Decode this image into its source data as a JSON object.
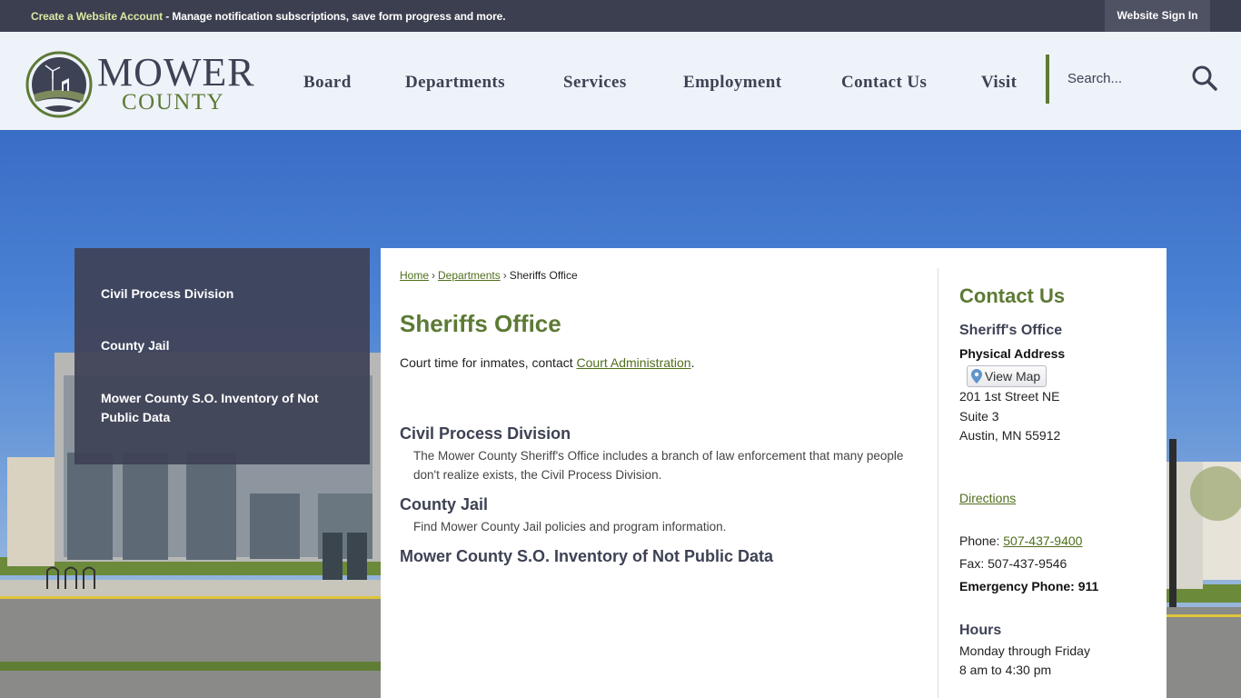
{
  "topbar": {
    "create_link": "Create a Website Account",
    "message": " - Manage notification subscriptions, save form progress and more.",
    "signin": "Website Sign In"
  },
  "logo": {
    "word1": "MOWER",
    "word2": "COUNTY"
  },
  "nav": {
    "items": [
      "Board",
      "Departments",
      "Services",
      "Employment",
      "Contact Us",
      "Visit"
    ],
    "search_placeholder": "Search..."
  },
  "sidebar": {
    "items": [
      "Civil Process Division",
      "County Jail",
      "Mower County S.O. Inventory of Not Public Data"
    ]
  },
  "breadcrumb": {
    "home": "Home",
    "departments": "Departments",
    "current": "Sheriffs Office",
    "sep": "›"
  },
  "page": {
    "title": "Sheriffs Office",
    "intro_text": "Court time for inmates, contact ",
    "intro_link": "Court Administration",
    "intro_end": ".",
    "sections": [
      {
        "title": "Civil Process Division",
        "desc": "The Mower County Sheriff's Office includes a branch of law enforcement that many people don't realize exists, the Civil Process Division."
      },
      {
        "title": "County Jail",
        "desc": "Find Mower County Jail policies and program information."
      },
      {
        "title": "Mower County S.O. Inventory of Not Public Data",
        "desc": ""
      }
    ]
  },
  "contact": {
    "heading": "Contact Us",
    "org": "Sheriff's Office",
    "physical_label": "Physical Address",
    "view_map": "View Map",
    "address1": "201 1st Street NE",
    "address2": "Suite 3",
    "address3": "Austin, MN 55912",
    "directions": "Directions",
    "phone_label": "Phone: ",
    "phone": "507-437-9400",
    "fax": "Fax: 507-437-9546",
    "emergency": "Emergency Phone: 911",
    "hours_heading": "Hours",
    "hours1": "Monday through Friday",
    "hours2": "8 am to 4:30 pm"
  },
  "colors": {
    "accent_green": "#5c7a35",
    "link_green": "#4f6f1c",
    "dark_navy": "#3d4254",
    "topbar": "#3c3f4f"
  }
}
